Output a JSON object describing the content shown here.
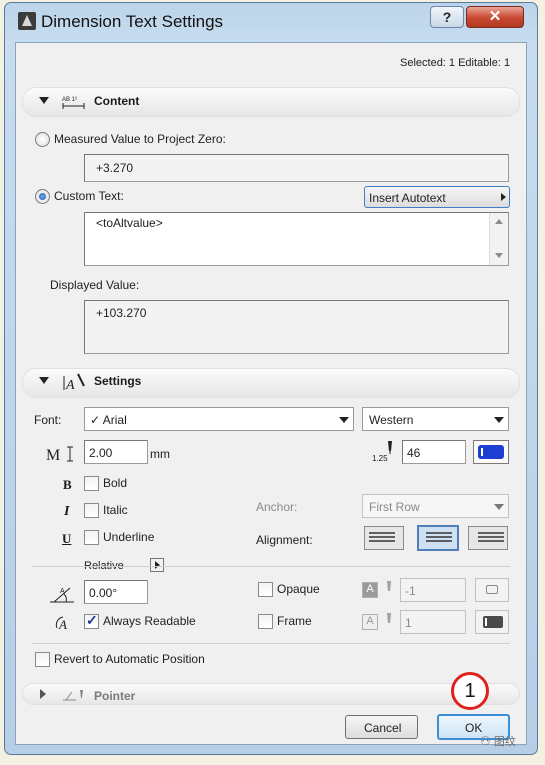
{
  "window": {
    "title": "Dimension Text Settings",
    "help_label": "?",
    "close_label": "✕"
  },
  "selected_info": "Selected: 1 Editable: 1",
  "content_section": {
    "title": "Content",
    "measured_label": "Measured Value to Project Zero:",
    "measured_value": "+3.270",
    "custom_label": "Custom Text:",
    "insert_autotext_label": "Insert Autotext",
    "custom_text_value": "<toAltvalue>",
    "displayed_label": "Displayed Value:",
    "displayed_value": "+103.270"
  },
  "settings_section": {
    "title": "Settings",
    "font_label": "Font:",
    "font_value": "✓ Arial",
    "script_value": "Western",
    "size_value": "2.00",
    "size_unit": "mm",
    "pen_number": "46",
    "pen_caption": "1.25",
    "bold_label": "Bold",
    "italic_label": "Italic",
    "underline_label": "Underline",
    "relative_label": "Relative",
    "angle_value": "0.00°",
    "always_readable_label": "Always Readable",
    "anchor_label": "Anchor:",
    "anchor_value": "First Row",
    "alignment_label": "Alignment:",
    "opaque_label": "Opaque",
    "opaque_pen_value": "-1",
    "frame_label": "Frame",
    "frame_pen_value": "1",
    "state": {
      "bold": false,
      "italic": false,
      "underline": false,
      "always_readable": true,
      "opaque": false,
      "frame": false,
      "alignment": "center"
    }
  },
  "revert_label": "Revert to Automatic Position",
  "pointer_section": {
    "title": "Pointer"
  },
  "footer": {
    "cancel_label": "Cancel",
    "ok_label": "OK"
  },
  "annotation": {
    "callout_number": "1",
    "watermark": "图纹"
  },
  "colors": {
    "accent": "#3c8fd6",
    "callout_red": "#e0221f",
    "pen_blue": "#1c3fd1"
  }
}
